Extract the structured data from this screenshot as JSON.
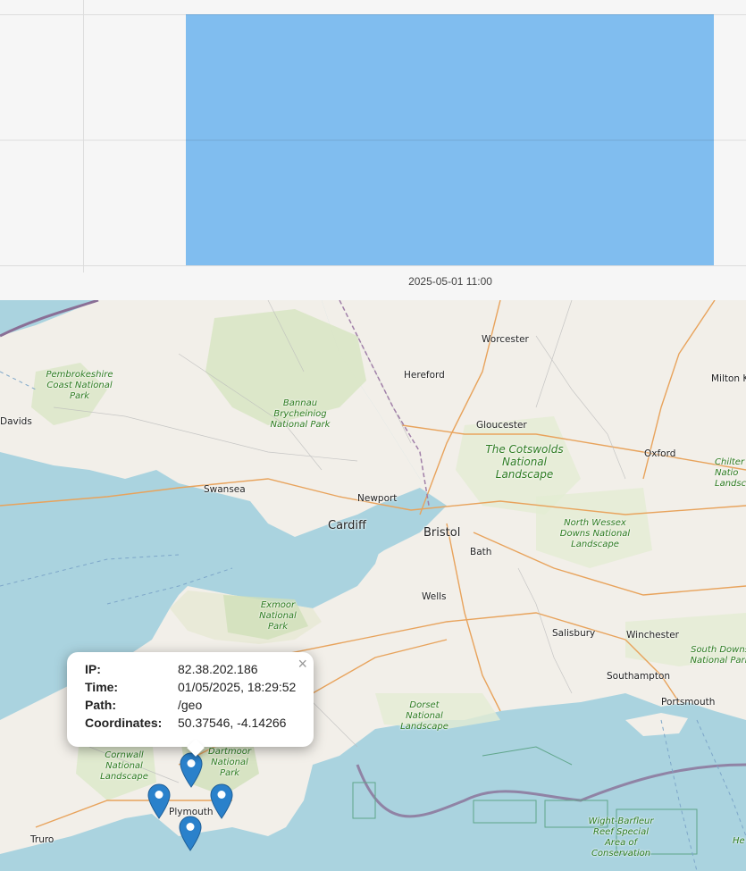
{
  "chart_data": {
    "type": "bar",
    "categories": [
      "2025-05-01 11:00"
    ],
    "values": [
      2
    ],
    "ylim": [
      0,
      2
    ],
    "grid": true,
    "color": "#80bdef"
  },
  "map": {
    "labels": {
      "worcester": "Worcester",
      "hereford": "Hereford",
      "milton_k": "Milton K",
      "pembrokeshire": "Pembrokeshire Coast National Park",
      "davids": "Davids",
      "bannau": "Bannau Brycheiniog National Park",
      "gloucester": "Gloucester",
      "cotswolds": "The Cotswolds National Landscape",
      "oxford": "Oxford",
      "chiltern": "Chilter Natio Landsc",
      "swansea": "Swansea",
      "newport": "Newport",
      "cardiff": "Cardiff",
      "bristol": "Bristol",
      "bath": "Bath",
      "north_wessex": "North Wessex Downs National Landscape",
      "exmoor": "Exmoor National Park",
      "wells": "Wells",
      "salisbury": "Salisbury",
      "winchester": "Winchester",
      "south_downs": "South Downs National Park",
      "southampton": "Southampton",
      "portsmouth": "Portsmouth",
      "dorset": "Dorset National Landscape",
      "cornwall": "Cornwall National Landscape",
      "dartmoor": "Dartmoor National Park",
      "plymouth": "Plymouth",
      "truro": "Truro",
      "wight": "Wight-Barfleur Reef Special Area of Conservation",
      "he": "He"
    },
    "markers": [
      {
        "name": "marker-1"
      },
      {
        "name": "marker-2"
      },
      {
        "name": "marker-3"
      },
      {
        "name": "marker-4"
      }
    ]
  },
  "popup": {
    "close": "×",
    "ip_label": "IP:",
    "ip_value": "82.38.202.186",
    "time_label": "Time:",
    "time_value": "01/05/2025, 18:29:52",
    "path_label": "Path:",
    "path_value": "/geo",
    "coords_label": "Coordinates:",
    "coords_value": "50.37546, -4.14266"
  },
  "colors": {
    "sea": "#aad3df",
    "land": "#f2efe9",
    "park": "#d8e8c8",
    "bar": "#80bdef"
  }
}
